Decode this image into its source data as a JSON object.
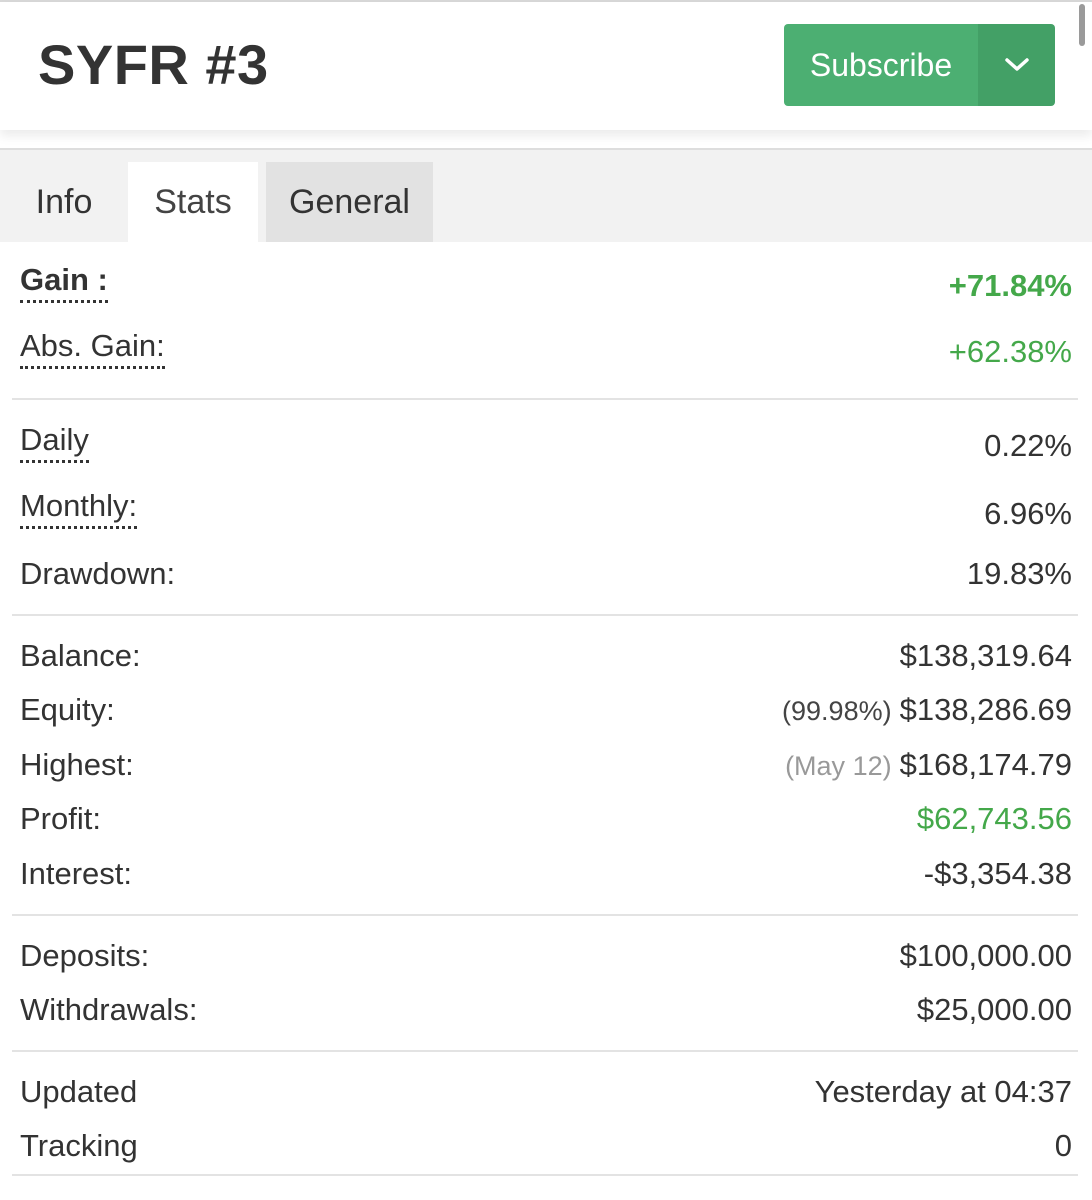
{
  "header": {
    "title": "SYFR #3",
    "subscribe_label": "Subscribe",
    "dropdown_icon": "chevron-down-icon"
  },
  "tabs": [
    {
      "label": "Info"
    },
    {
      "label": "Stats"
    },
    {
      "label": "General"
    }
  ],
  "stats": {
    "gain": {
      "label": "Gain :",
      "value": "+71.84%"
    },
    "abs_gain": {
      "label": "Abs. Gain:",
      "value": "+62.38%"
    },
    "daily": {
      "label": "Daily",
      "value": "0.22%"
    },
    "monthly": {
      "label": "Monthly:",
      "value": "6.96%"
    },
    "drawdown": {
      "label": "Drawdown:",
      "value": "19.83%"
    },
    "balance": {
      "label": "Balance:",
      "value": "$138,319.64"
    },
    "equity": {
      "label": "Equity:",
      "note": "(99.98%)",
      "value": "$138,286.69"
    },
    "highest": {
      "label": "Highest:",
      "note": "(May 12)",
      "value": "$168,174.79"
    },
    "profit": {
      "label": "Profit:",
      "value": "$62,743.56"
    },
    "interest": {
      "label": "Interest:",
      "value": "-$3,354.38"
    },
    "deposits": {
      "label": "Deposits:",
      "value": "$100,000.00"
    },
    "withdrawals": {
      "label": "Withdrawals:",
      "value": "$25,000.00"
    },
    "updated": {
      "label": "Updated",
      "value": "Yesterday at 04:37"
    },
    "tracking": {
      "label": "Tracking",
      "value": "0"
    }
  },
  "colors": {
    "accent_green": "#4caf72",
    "positive_text": "#44a84a"
  }
}
